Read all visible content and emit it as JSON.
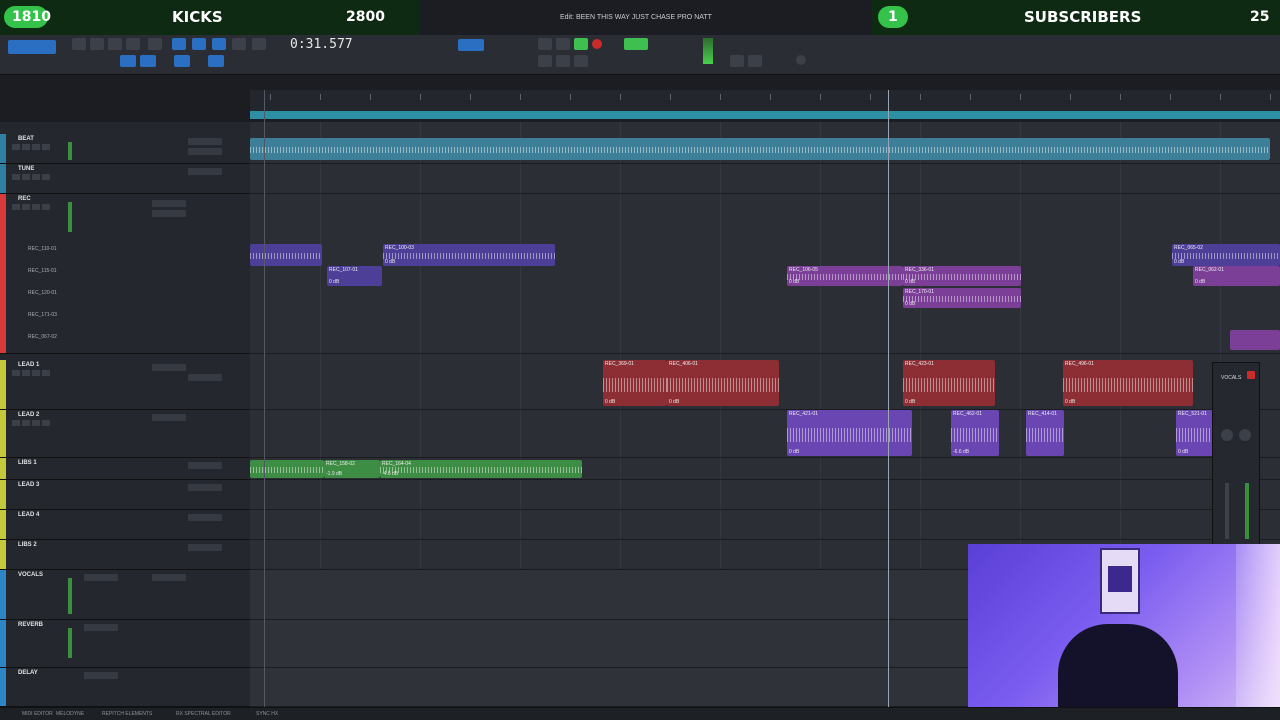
{
  "overlay": {
    "left_count": "1810",
    "left_label": "KICKS",
    "left_goal": "2800",
    "right_count": "1",
    "right_label": "SUBSCRIBERS",
    "right_goal": "25"
  },
  "window": {
    "title": "Edit: BEEN THIS WAY JUST CHASE PRO NATT"
  },
  "transport": {
    "counter": "0:31.577"
  },
  "tracks": [
    {
      "name": "BEAT",
      "color": "#2e7fa0"
    },
    {
      "name": "TUNE",
      "color": "#2e7fa0"
    },
    {
      "name": "REC",
      "color": "#d63a3a"
    },
    {
      "name": "LEAD 1",
      "color": "#c4c93a"
    },
    {
      "name": "LEAD 2",
      "color": "#c4c93a"
    },
    {
      "name": "LIBS 1",
      "color": "#c4c93a"
    },
    {
      "name": "LEAD 3",
      "color": "#c4c93a"
    },
    {
      "name": "LEAD 4",
      "color": "#c4c93a"
    },
    {
      "name": "LIBS 2",
      "color": "#c4c93a"
    },
    {
      "name": "VOCALS",
      "color": "#2e86c6"
    },
    {
      "name": "REVERB",
      "color": "#2e86c6"
    },
    {
      "name": "DELAY",
      "color": "#2e86c6"
    }
  ],
  "playlist_labels": [
    "REC_110-01",
    "REC_115-01",
    "REC_120-01",
    "REC_171-03",
    "REC_067-02"
  ],
  "clips": {
    "rec_1": {
      "name": "REC_100-03",
      "gain": "0 dB"
    },
    "rec_2": {
      "name": "REC_107-01",
      "gain": "0 dB"
    },
    "rec_3": {
      "name": "REC_106-05",
      "gain": "0 dB"
    },
    "rec_4": {
      "name": "REC_336-01",
      "gain": "0 dB"
    },
    "rec_5": {
      "name": "REC_170-01",
      "gain": "0 dB"
    },
    "rec_6": {
      "name": "REC_065-02",
      "gain": "0 dB"
    },
    "rec_7": {
      "name": "REC_062-01",
      "gain": "0 dB"
    },
    "lead_1": {
      "name": "REC_369-01",
      "gain": "0 dB"
    },
    "lead_2": {
      "name": "REC_406-01",
      "gain": "0 dB"
    },
    "lead_3": {
      "name": "REC_423-01",
      "gain": "0 dB"
    },
    "lead_4": {
      "name": "REC_496-01",
      "gain": "0 dB"
    },
    "lead2_1": {
      "name": "REC_421-01",
      "gain": "0 dB"
    },
    "lead2_2": {
      "name": "REC_462-01",
      "gain": "-6.6 dB"
    },
    "lead2_3": {
      "name": "REC_414-01",
      "gain": ""
    },
    "lead2_4": {
      "name": "REC_521-01",
      "gain": "0 dB"
    },
    "libs_1": {
      "name": "REC_158-02",
      "gain": "-1.9 dB"
    },
    "libs_2": {
      "name": "REC_164-04",
      "gain": "-4.6 dB"
    }
  },
  "mini_mixer": {
    "label": "VOCALS"
  },
  "bottom": {
    "items": [
      "MIDI EDITOR",
      "MELODYNE",
      "REPITCH ELEMENTS",
      "RX SPECTRAL EDITOR",
      "SYNC HX"
    ]
  }
}
